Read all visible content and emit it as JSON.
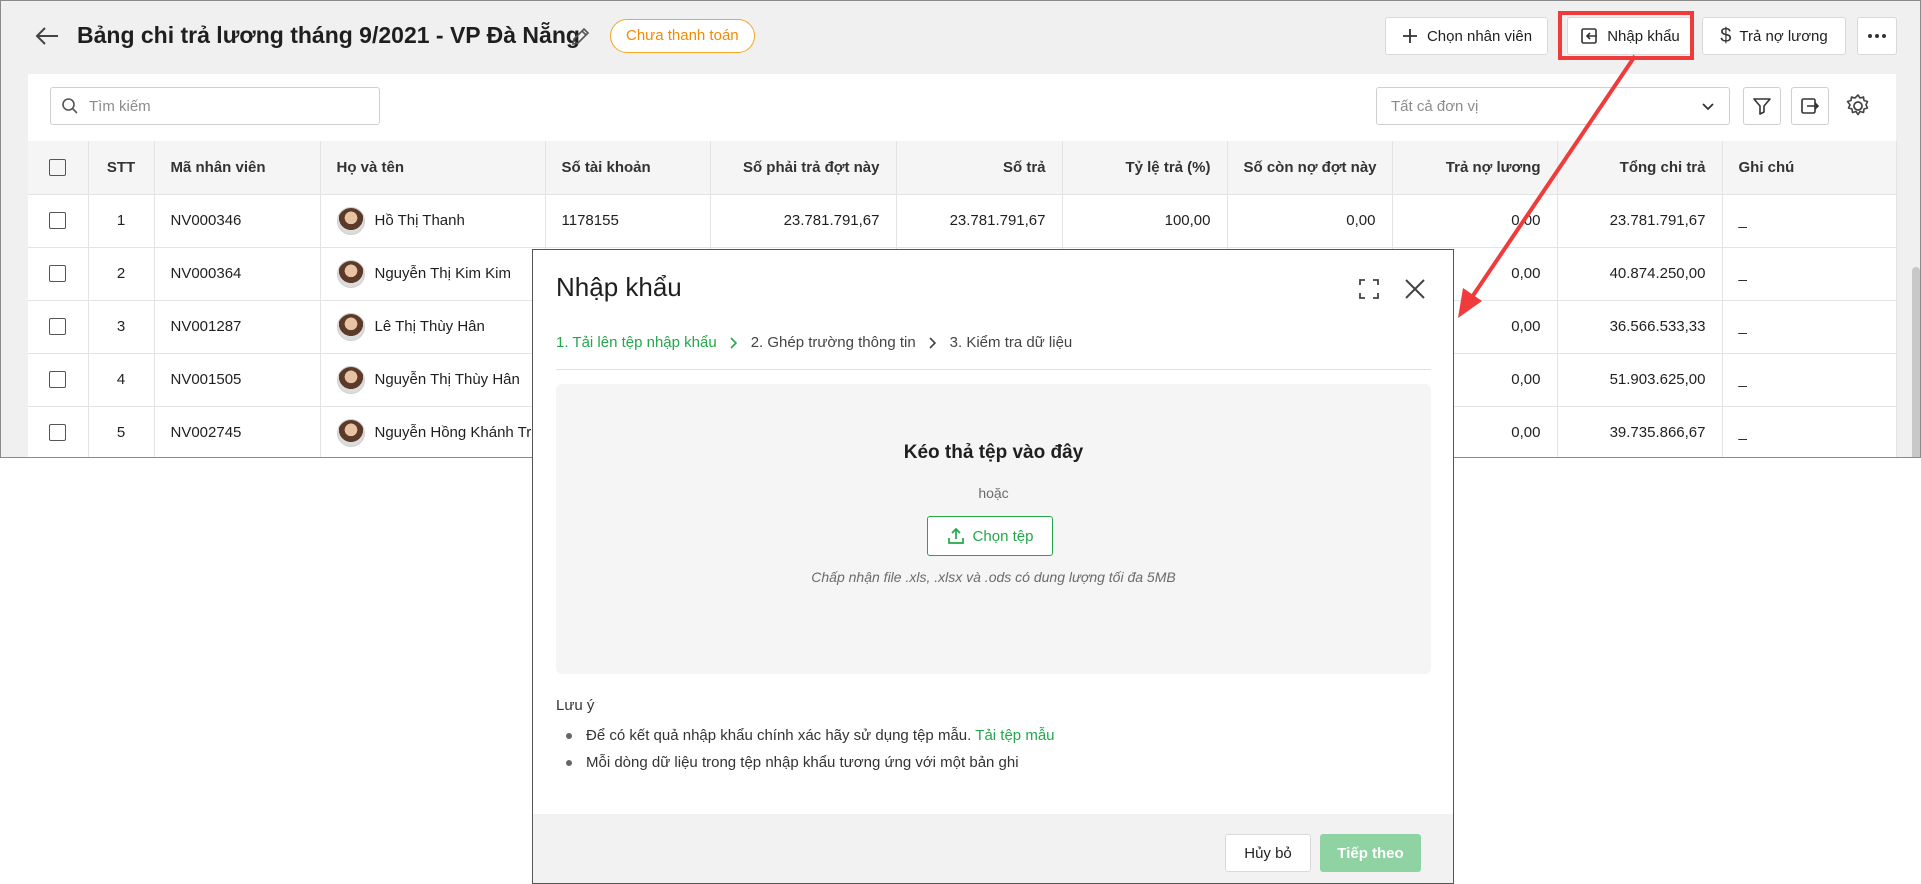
{
  "header": {
    "title": "Bảng chi trả lương tháng 9/2021 - VP Đà Nẵng",
    "status_badge": "Chưa thanh toán",
    "buttons": {
      "add_employee": "Chọn nhân viên",
      "import": "Nhập khẩu",
      "repay": "Trả nợ lương"
    }
  },
  "toolbar": {
    "search_placeholder": "Tìm kiếm",
    "unit_select_value": "Tất cả đơn vị"
  },
  "table": {
    "columns": [
      "STT",
      "Mã nhân viên",
      "Họ và tên",
      "Số tài khoản",
      "Số phải trả đợt này",
      "Số trả",
      "Tỷ lệ trả (%)",
      "Số còn nợ đợt này",
      "Trả nợ lương",
      "Tổng chi trả",
      "Ghi chú"
    ],
    "rows": [
      {
        "stt": "1",
        "code": "NV000346",
        "name": "Hồ Thị Thanh",
        "account": "1178155",
        "due": "23.781.791,67",
        "paid": "23.781.791,67",
        "rate": "100,00",
        "remaining": "0,00",
        "repay": "0,00",
        "total": "23.781.791,67",
        "note": "_"
      },
      {
        "stt": "2",
        "code": "NV000364",
        "name": "Nguyễn Thị Kim Kim",
        "account": "",
        "due": "",
        "paid": "",
        "rate": "",
        "remaining": "",
        "repay": "0,00",
        "total": "40.874.250,00",
        "note": "_"
      },
      {
        "stt": "3",
        "code": "NV001287",
        "name": "Lê Thị Thùy Hân",
        "account": "",
        "due": "",
        "paid": "",
        "rate": "",
        "remaining": "",
        "repay": "0,00",
        "total": "36.566.533,33",
        "note": "_"
      },
      {
        "stt": "4",
        "code": "NV001505",
        "name": "Nguyễn Thị Thùy Hân",
        "account": "",
        "due": "",
        "paid": "",
        "rate": "",
        "remaining": "",
        "repay": "0,00",
        "total": "51.903.625,00",
        "note": "_"
      },
      {
        "stt": "5",
        "code": "NV002745",
        "name": "Nguyễn Hồng Khánh Tr",
        "account": "",
        "due": "",
        "paid": "",
        "rate": "",
        "remaining": "",
        "repay": "0,00",
        "total": "39.735.866,67",
        "note": "_"
      }
    ]
  },
  "modal": {
    "title": "Nhập khẩu",
    "steps": [
      "1. Tải lên tệp nhập khẩu",
      "2. Ghép trường thông tin",
      "3. Kiểm tra dữ liệu"
    ],
    "active_step": 1,
    "dropzone": {
      "title": "Kéo thả tệp vào đây",
      "or": "hoặc",
      "choose_button": "Chọn tệp",
      "hint": "Chấp nhận file .xls, .xlsx và .ods có dung lượng tối đa 5MB"
    },
    "notes_title": "Lưu ý",
    "notes": [
      {
        "text": "Để có kết quả nhập khẩu chính xác hãy sử dụng tệp mẫu.",
        "link": "Tải tệp mẫu"
      },
      {
        "text": "Mỗi dòng dữ liệu trong tệp nhập khẩu tương ứng với một bản ghi",
        "link": ""
      }
    ],
    "cancel_button": "Hủy bỏ",
    "next_button": "Tiếp theo"
  },
  "colors": {
    "accent_green": "#22a84a",
    "badge_orange": "#f08c00",
    "annotation_red": "#ef3b3b",
    "next_disabled": "#8fd3a3"
  }
}
